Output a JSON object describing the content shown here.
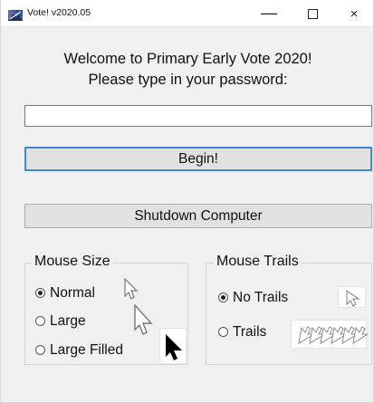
{
  "window": {
    "title": "Vote! v2020.05",
    "controls": {
      "minimize": "—",
      "maximize": "",
      "close": "×"
    }
  },
  "welcome": {
    "line1": "Welcome to Primary Early Vote 2020!",
    "line2": "Please type in your password:"
  },
  "password": {
    "value": "",
    "placeholder": ""
  },
  "buttons": {
    "begin": "Begin!",
    "shutdown": "Shutdown Computer"
  },
  "mouse_size": {
    "title": "Mouse Size",
    "selected": "Normal",
    "options": [
      {
        "label": "Normal",
        "selected": true
      },
      {
        "label": "Large",
        "selected": false
      },
      {
        "label": "Large Filled",
        "selected": false
      }
    ]
  },
  "mouse_trails": {
    "title": "Mouse Trails",
    "selected": "No Trails",
    "options": [
      {
        "label": "No Trails",
        "selected": true
      },
      {
        "label": "Trails",
        "selected": false
      }
    ]
  },
  "icons": {
    "app": "ballot-icon",
    "normal_cursor": "arrow-cursor-icon",
    "large_cursor": "large-arrow-cursor-icon",
    "large_filled_cursor": "filled-arrow-cursor-icon",
    "no_trails_cursor": "arrow-cursor-icon",
    "trails_cursor": "cursor-trail-icon"
  },
  "colors": {
    "window_background": "#f0f0f0",
    "title_background": "#ffffff",
    "focus_border": "#3d87d8",
    "button_background": "#e1e1e1"
  }
}
